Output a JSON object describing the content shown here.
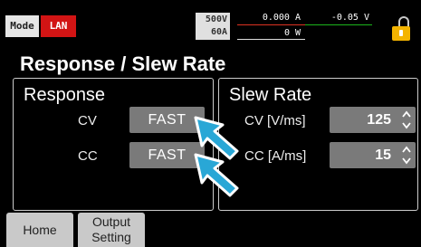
{
  "statusbar": {
    "mode_label": "Mode",
    "interface_label": "LAN",
    "voltage_limit": "500V",
    "current_limit": "60A",
    "current_reading": "0.000 A",
    "voltage_reading": "-0.05 V",
    "power_reading": "0 W",
    "lock_icon": "padlock-unlocked-icon"
  },
  "page": {
    "title": "Response / Slew Rate"
  },
  "response_panel": {
    "title": "Response",
    "rows": [
      {
        "label": "CV",
        "value": "FAST"
      },
      {
        "label": "CC",
        "value": "FAST"
      }
    ]
  },
  "slew_panel": {
    "title": "Slew Rate",
    "rows": [
      {
        "label": "CV [V/ms]",
        "value": "125"
      },
      {
        "label": "CC [A/ms]",
        "value": "15"
      }
    ]
  },
  "softkeys": {
    "home": "Home",
    "output_setting": "Output\nSetting"
  },
  "colors": {
    "interface_badge": "#d21414",
    "lock": "#f4b400",
    "pointer_arrow": "#29a7d6",
    "current_rule": "#dd3322",
    "voltage_rule": "#1bb41b"
  }
}
